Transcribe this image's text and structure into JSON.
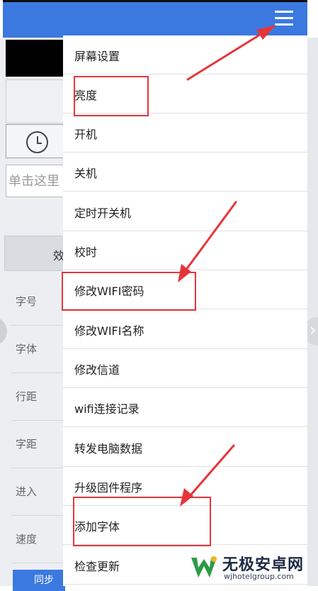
{
  "header": {
    "menu_icon": "hamburger-menu-icon",
    "color": "#3b79e0"
  },
  "background": {
    "clock_icon": "clock-icon",
    "input_placeholder": "单击这里",
    "table_header": "效",
    "row_labels": [
      "字号",
      "字体",
      "行距",
      "字距",
      "进入",
      "速度"
    ],
    "button_label": "同步"
  },
  "menu": {
    "items": [
      "屏幕设置",
      "亮度",
      "开机",
      "关机",
      "定时开关机",
      "校时",
      "修改WIFI密码",
      "修改WIFI名称",
      "修改信道",
      "wifi连接记录",
      "转发电脑数据",
      "升级固件程序",
      "添加字体",
      "检查更新"
    ],
    "highlighted": [
      "亮度",
      "修改WIFI密码",
      "添加字体"
    ],
    "highlight_color": "#e5353a"
  },
  "watermark": {
    "title": "无极安卓网",
    "url": "wjhotelgroup.com"
  }
}
